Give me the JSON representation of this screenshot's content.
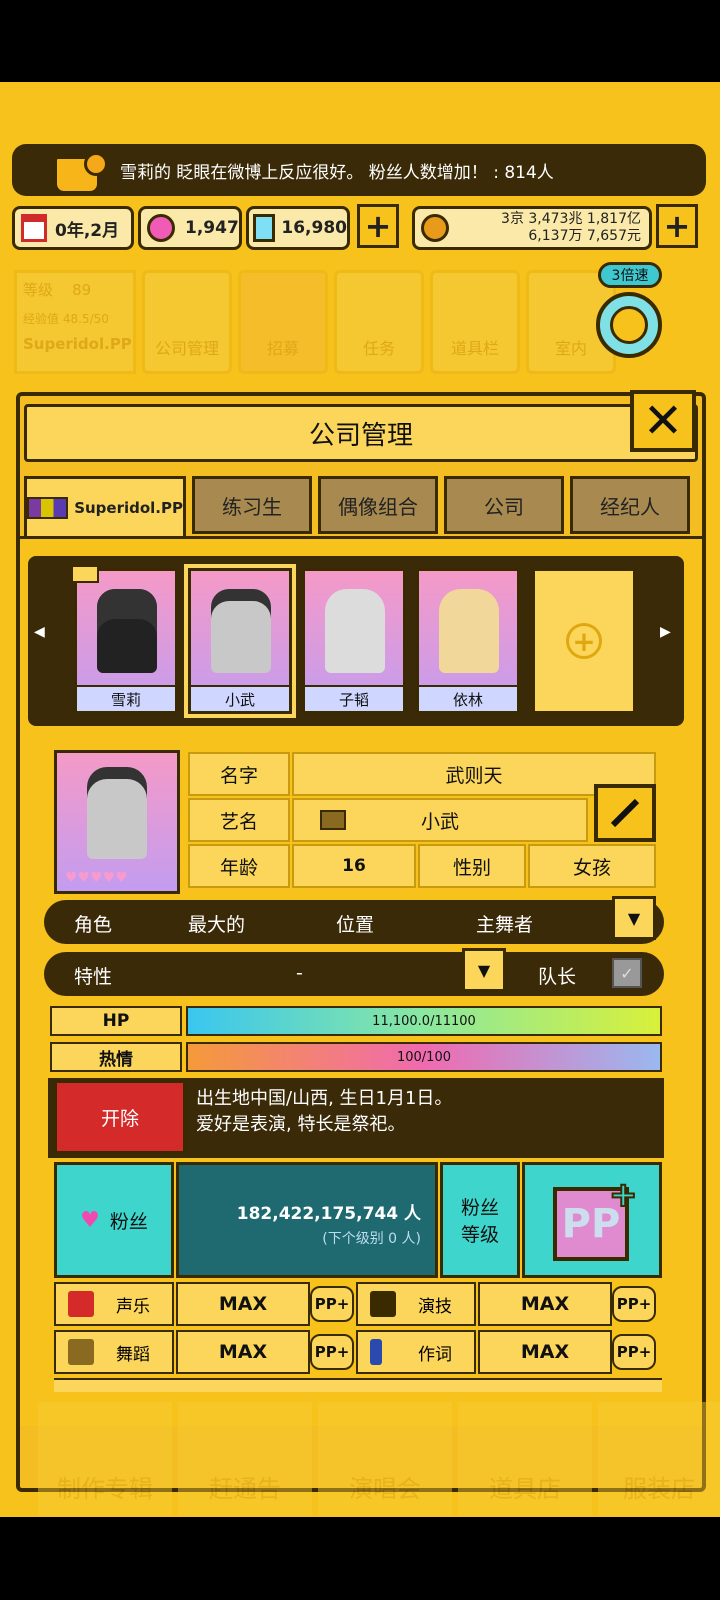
{
  "news": {
    "text": "雪莉的 眨眼在微博上反应很好。 粉丝人数增加！ : 814人"
  },
  "resources": {
    "date": "0年,2月",
    "pink_gems": "1,947",
    "diamonds": "16,980",
    "money_line1": "3京 3,473兆 1,817亿",
    "money_line2": "6,137万 7,657元",
    "plus": "+"
  },
  "speed": {
    "label": "3倍速"
  },
  "background_menu": {
    "level_label": "等级",
    "level_value": "89",
    "exp_label": "经验值",
    "exp_value": "48.5/50",
    "company": "Superidol.PP",
    "tiles": [
      "公司管理",
      "招募",
      "任务",
      "道具栏",
      "室内"
    ]
  },
  "panel": {
    "title": "公司管理",
    "close": "✕",
    "tabs": [
      "Superidol.PP",
      "练习生",
      "偶像组合",
      "公司",
      "经纪人"
    ],
    "roster": [
      {
        "name": "雪莉",
        "color": "#f59ac7"
      },
      {
        "name": "小武",
        "color": "#f59ac7"
      },
      {
        "name": "子韬",
        "color": "#f59ac7"
      },
      {
        "name": "依林",
        "color": "#f59ac7"
      }
    ],
    "add_slot": "+"
  },
  "profile": {
    "name_label": "名字",
    "name_value": "武则天",
    "stage_label": "艺名",
    "stage_value": "小武",
    "age_label": "年龄",
    "age_value": "16",
    "gender_label": "性别",
    "gender_value": "女孩",
    "role_label": "角色",
    "role_value": "最大的",
    "position_label": "位置",
    "position_value": "主舞者",
    "trait_label": "特性",
    "trait_value": "-",
    "leader_label": "队长",
    "hp_label": "HP",
    "hp_value": "11,100.0/11100",
    "hp_fraction": 1.0,
    "passion_label": "热情",
    "passion_value": "100/100",
    "passion_fraction": 1.0,
    "fire_label": "开除",
    "bio_line1": "出生地中国/山西, 生日1月1日。",
    "bio_line2": "爱好是表演, 特长是祭祀。",
    "fans_label": "粉丝",
    "fans_value": "182,422,175,744 人",
    "fans_next": "(下个级别 0 人)",
    "fan_level_label_1": "粉丝",
    "fan_level_label_2": "等级",
    "pp_logo": "PP"
  },
  "stats": [
    {
      "label": "声乐",
      "value": "MAX",
      "pp": "PP+"
    },
    {
      "label": "演技",
      "value": "MAX",
      "pp": "PP+"
    },
    {
      "label": "舞蹈",
      "value": "MAX",
      "pp": "PP+"
    },
    {
      "label": "作词",
      "value": "MAX",
      "pp": "PP+"
    }
  ],
  "bottom_nav": [
    "制作专辑",
    "赶通告",
    "演唱会",
    "道具店",
    "服装店"
  ]
}
